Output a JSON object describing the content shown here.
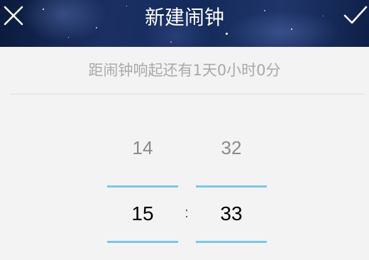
{
  "header": {
    "title": "新建闹钟",
    "close_icon": "close-icon",
    "confirm_icon": "check-icon"
  },
  "countdown": {
    "text": "距闹钟响起还有1天0小时0分"
  },
  "picker": {
    "hour_above": "14",
    "hour_selected": "15",
    "minute_above": "32",
    "minute_selected": "33",
    "separator": ":"
  },
  "colors": {
    "accent_line": "#7bc7e6",
    "background": "#f3f3f3"
  }
}
